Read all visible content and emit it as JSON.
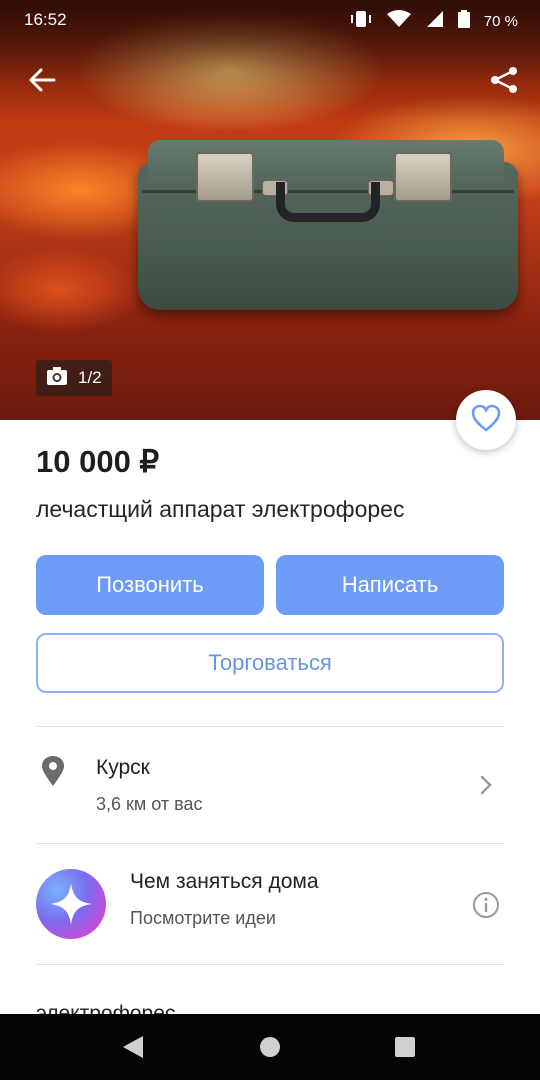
{
  "status_bar": {
    "time": "16:52",
    "battery": "70 %"
  },
  "photo": {
    "counter": "1/2"
  },
  "listing": {
    "price": "10 000 ₽",
    "title": "лечастщий аппарат электрофорес"
  },
  "actions": {
    "call_label": "Позвонить",
    "message_label": "Написать",
    "bargain_label": "Торговаться"
  },
  "location": {
    "city": "Курск",
    "distance": "3,6 км от вас"
  },
  "promo": {
    "title": "Чем заняться дома",
    "subtitle": "Посмотрите идеи"
  },
  "description": {
    "preview": "электрофорес"
  },
  "icons": {
    "back": "arrow-left-icon",
    "share": "share-icon",
    "camera": "camera-icon",
    "favorite": "heart-icon",
    "location": "map-pin-icon",
    "chevron": "chevron-right-icon",
    "info": "info-icon",
    "nav_back": "triangle-back-icon",
    "nav_home": "circle-home-icon",
    "nav_recents": "square-recents-icon"
  },
  "colors": {
    "accent": "#6e9bf5",
    "outline_accent": "#8fb0f2",
    "navbar": "#050505"
  }
}
